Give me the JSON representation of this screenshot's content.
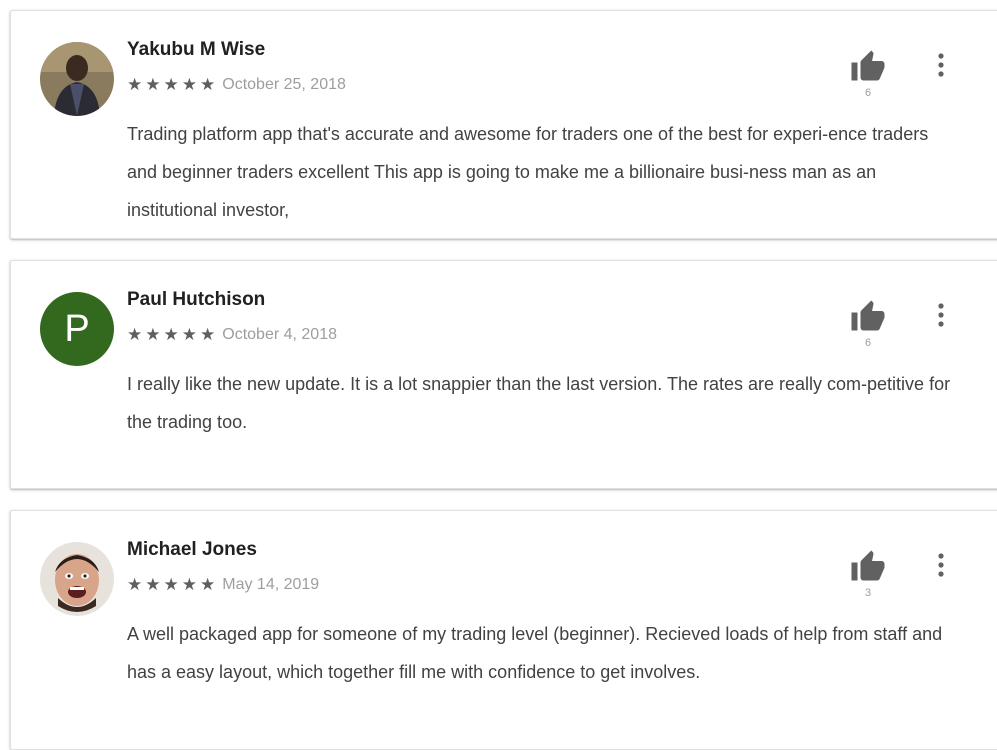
{
  "reviews": [
    {
      "author": "Yakubu M Wise",
      "rating": 5,
      "rating_max": 5,
      "date": "October 25, 2018",
      "text": "Trading platform app that's accurate and awesome for traders one of the best for experi-ence traders and beginner traders excellent This app is going to make me a billionaire busi-ness man as an institutional investor,",
      "helpful_count": "6",
      "avatar": "photo"
    },
    {
      "author": "Paul Hutchison",
      "rating": 5,
      "rating_max": 5,
      "date": "October 4, 2018",
      "text": "I really like the new update. It is a lot snappier than the last version. The rates are really com-petitive for the trading too.",
      "helpful_count": "6",
      "avatar": "initial",
      "avatar_initial": "P",
      "avatar_color": "#33691e"
    },
    {
      "author": "Michael Jones",
      "rating": 5,
      "rating_max": 5,
      "date": "May 14, 2019",
      "text": "A well packaged app for someone of my trading level (beginner). Recieved loads of help from staff and has a easy layout, which together fill me with confidence to get involves.",
      "helpful_count": "3",
      "avatar": "photo"
    }
  ],
  "icons": {
    "helpful": "thumbs-up-icon",
    "menu": "more-vert-icon",
    "star": "star-icon"
  },
  "colors": {
    "star": "#5f5f5f",
    "date": "#9e9e9e",
    "body_text": "#424242",
    "icon": "#616161"
  }
}
